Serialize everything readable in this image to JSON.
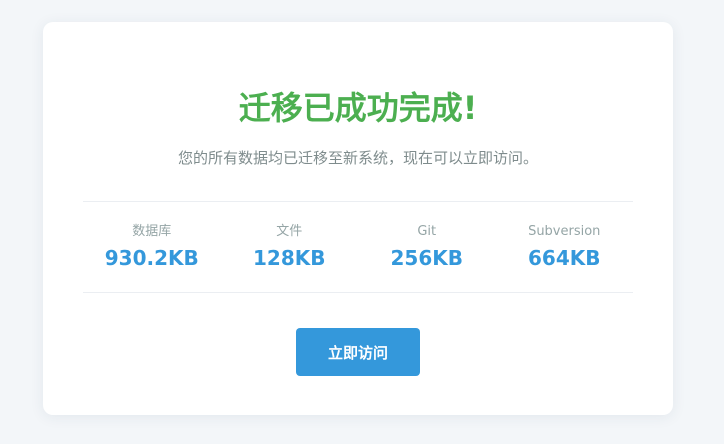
{
  "title": "迁移已成功完成!",
  "subtitle": "您的所有数据均已迁移至新系统，现在可以立即访问。",
  "stats": [
    {
      "label": "数据库",
      "value": "930.2KB"
    },
    {
      "label": "文件",
      "value": "128KB"
    },
    {
      "label": "Git",
      "value": "256KB"
    },
    {
      "label": "Subversion",
      "value": "664KB"
    }
  ],
  "button": {
    "label": "立即访问"
  },
  "colors": {
    "success": "#4caf50",
    "accent": "#3498db",
    "muted_text": "#7f8c8d",
    "background": "#f3f6f9"
  }
}
